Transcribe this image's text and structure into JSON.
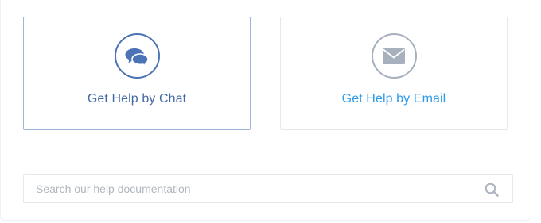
{
  "help_options": {
    "chat": {
      "label": "Get Help by Chat",
      "icon": "chat-bubbles-icon",
      "color": "#456aa6",
      "active": true
    },
    "email": {
      "label": "Get Help by Email",
      "icon": "envelope-icon",
      "color": "#2e9be6",
      "active": false
    }
  },
  "search": {
    "placeholder": "Search our help documentation",
    "value": "",
    "icon": "search-icon"
  }
}
